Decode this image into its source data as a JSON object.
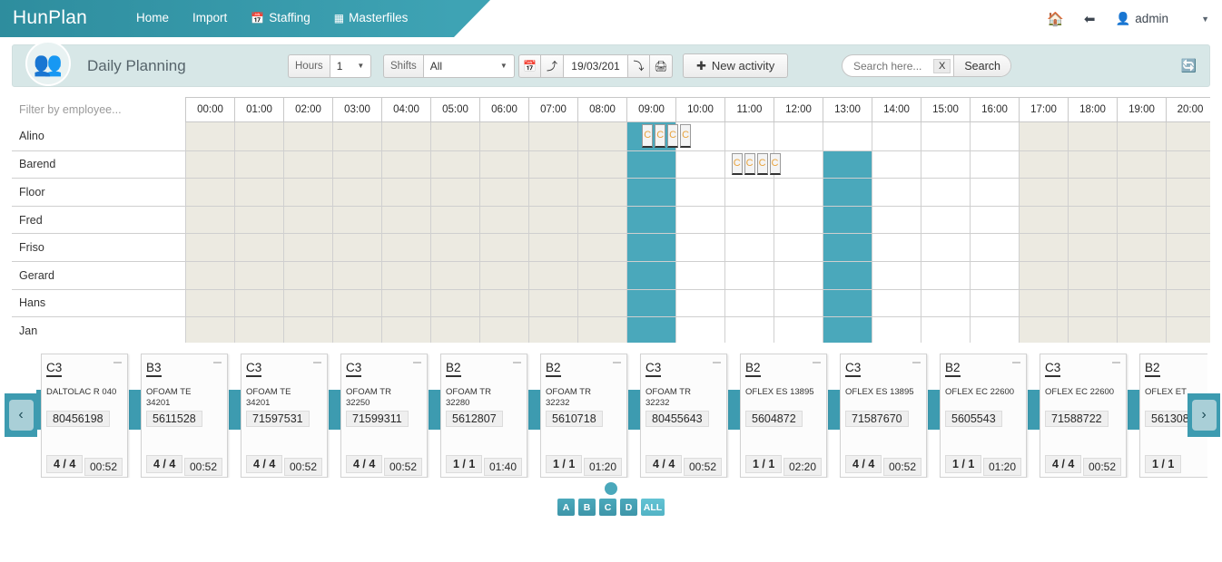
{
  "brand": "HunPlan",
  "nav": [
    {
      "label": "Home",
      "icon": ""
    },
    {
      "label": "Import",
      "icon": ""
    },
    {
      "label": "Staffing",
      "icon": "calendar-icon"
    },
    {
      "label": "Masterfiles",
      "icon": "table-icon"
    }
  ],
  "topright": {
    "home_icon": "home-icon",
    "back_icon": "arrow-left-icon",
    "user_icon": "user-icon",
    "user": "admin",
    "caret": "caret-down-icon"
  },
  "toolbar": {
    "avatar_icon": "users-icon",
    "title": "Daily Planning",
    "hours_label": "Hours",
    "hours_value": "1",
    "shifts_label": "Shifts",
    "shifts_value": "All",
    "calendar_icon": "calendar-icon",
    "prev_icon": "arrow-left-circle-icon",
    "date_value": "19/03/201",
    "next_icon": "arrow-right-circle-icon",
    "print_icon": "printer-icon",
    "new_activity": "New activity",
    "new_activity_icon": "plus-circle-icon",
    "search_placeholder": "Search here...",
    "search_clear": "X",
    "search_button": "Search",
    "refresh_icon": "refresh-icon"
  },
  "grid": {
    "filter_placeholder": "Filter by employee...",
    "times": [
      "00:00",
      "01:00",
      "02:00",
      "03:00",
      "04:00",
      "05:00",
      "06:00",
      "07:00",
      "08:00",
      "09:00",
      "10:00",
      "11:00",
      "12:00",
      "13:00",
      "14:00",
      "15:00",
      "16:00",
      "17:00",
      "18:00",
      "19:00",
      "20:00"
    ],
    "employees": [
      "Alino",
      "Barend",
      "Floor",
      "Fred",
      "Friso",
      "Gerard",
      "Hans",
      "Jan"
    ]
  },
  "cards": [
    {
      "code": "C3",
      "desc": "DALTOLAC R 040",
      "number": "80456198",
      "ratio": "4 / 4",
      "time": "00:52"
    },
    {
      "code": "B3",
      "desc": "OFOAM TE\n34201",
      "number": "5611528",
      "ratio": "4 / 4",
      "time": "00:52"
    },
    {
      "code": "C3",
      "desc": "OFOAM TE\n34201",
      "number": "71597531",
      "ratio": "4 / 4",
      "time": "00:52"
    },
    {
      "code": "C3",
      "desc": "OFOAM TR\n32250",
      "number": "71599311",
      "ratio": "4 / 4",
      "time": "00:52"
    },
    {
      "code": "B2",
      "desc": "OFOAM TR\n32280",
      "number": "5612807",
      "ratio": "1 / 1",
      "time": "01:40"
    },
    {
      "code": "B2",
      "desc": "OFOAM TR\n32232",
      "number": "5610718",
      "ratio": "1 / 1",
      "time": "01:20"
    },
    {
      "code": "C3",
      "desc": "OFOAM TR\n32232",
      "number": "80455643",
      "ratio": "4 / 4",
      "time": "00:52"
    },
    {
      "code": "B2",
      "desc": "OFLEX ES 13895",
      "number": "5604872",
      "ratio": "1 / 1",
      "time": "02:20"
    },
    {
      "code": "C3",
      "desc": "OFLEX ES 13895",
      "number": "71587670",
      "ratio": "4 / 4",
      "time": "00:52"
    },
    {
      "code": "B2",
      "desc": "OFLEX EC 22600",
      "number": "5605543",
      "ratio": "1 / 1",
      "time": "01:20"
    },
    {
      "code": "C3",
      "desc": "OFLEX EC 22600",
      "number": "71588722",
      "ratio": "4 / 4",
      "time": "00:52"
    },
    {
      "code": "B2",
      "desc": "OFLEX ET",
      "number": "561308",
      "ratio": "1 / 1",
      "time": ""
    }
  ],
  "card_nav": {
    "left": "‹",
    "right": "›"
  },
  "pager": {
    "buttons": [
      "A",
      "B",
      "C",
      "D"
    ],
    "all_label": "ALL"
  },
  "colors": {
    "brand_teal": "#3ea3b4",
    "accent_teal": "#4aa8bb",
    "toolbar_bg": "#d7e7e7",
    "row_shade": "#eceae1"
  }
}
